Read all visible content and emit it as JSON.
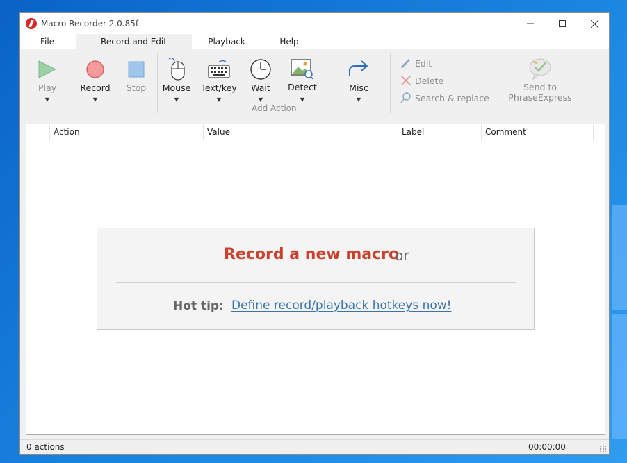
{
  "window": {
    "title": "Macro Recorder 2.0.85f",
    "minimize_icon": "minimize-icon",
    "maximize_icon": "maximize-icon",
    "close_icon": "close-icon"
  },
  "menu": {
    "tabs": [
      "File",
      "Record and Edit",
      "Playback",
      "Help"
    ],
    "active_tab": "Record and Edit"
  },
  "ribbon": {
    "play": {
      "label": "Play",
      "icon": "play-icon"
    },
    "record": {
      "label": "Record",
      "icon": "record-icon"
    },
    "stop": {
      "label": "Stop",
      "icon": "stop-icon"
    },
    "mouse": {
      "label": "Mouse",
      "icon": "mouse-icon"
    },
    "textkey": {
      "label": "Text/key",
      "icon": "keyboard-icon"
    },
    "wait": {
      "label": "Wait",
      "icon": "clock-icon"
    },
    "detect": {
      "label": "Detect",
      "icon": "image-detect-icon"
    },
    "add_action_group": "Add Action",
    "misc": {
      "label": "Misc",
      "icon": "redo-arrow-icon"
    },
    "edit": {
      "label": "Edit",
      "icon": "pencil-icon"
    },
    "delete": {
      "label": "Delete",
      "icon": "x-icon"
    },
    "search_replace": {
      "label": "Search & replace",
      "icon": "magnifier-icon"
    },
    "send_to": {
      "line1": "Send to",
      "line2": "PhraseExpress",
      "icon": "phraseexpress-icon"
    }
  },
  "table": {
    "columns": [
      "Action",
      "Value",
      "Label",
      "Comment"
    ],
    "rows": []
  },
  "empty_panel": {
    "record_link": "Record a new macro",
    "or_text": "or",
    "tip_label": "Hot tip:",
    "tip_link": "Define record/playback hotkeys now!"
  },
  "status": {
    "count": "0 actions",
    "time": "00:00:00"
  },
  "colors": {
    "accent_red": "#c8432f",
    "link_blue": "#3a74a8",
    "play_green": "#9fd1a8",
    "record_red": "#f39b9b",
    "stop_blue": "#9fc7ec"
  }
}
